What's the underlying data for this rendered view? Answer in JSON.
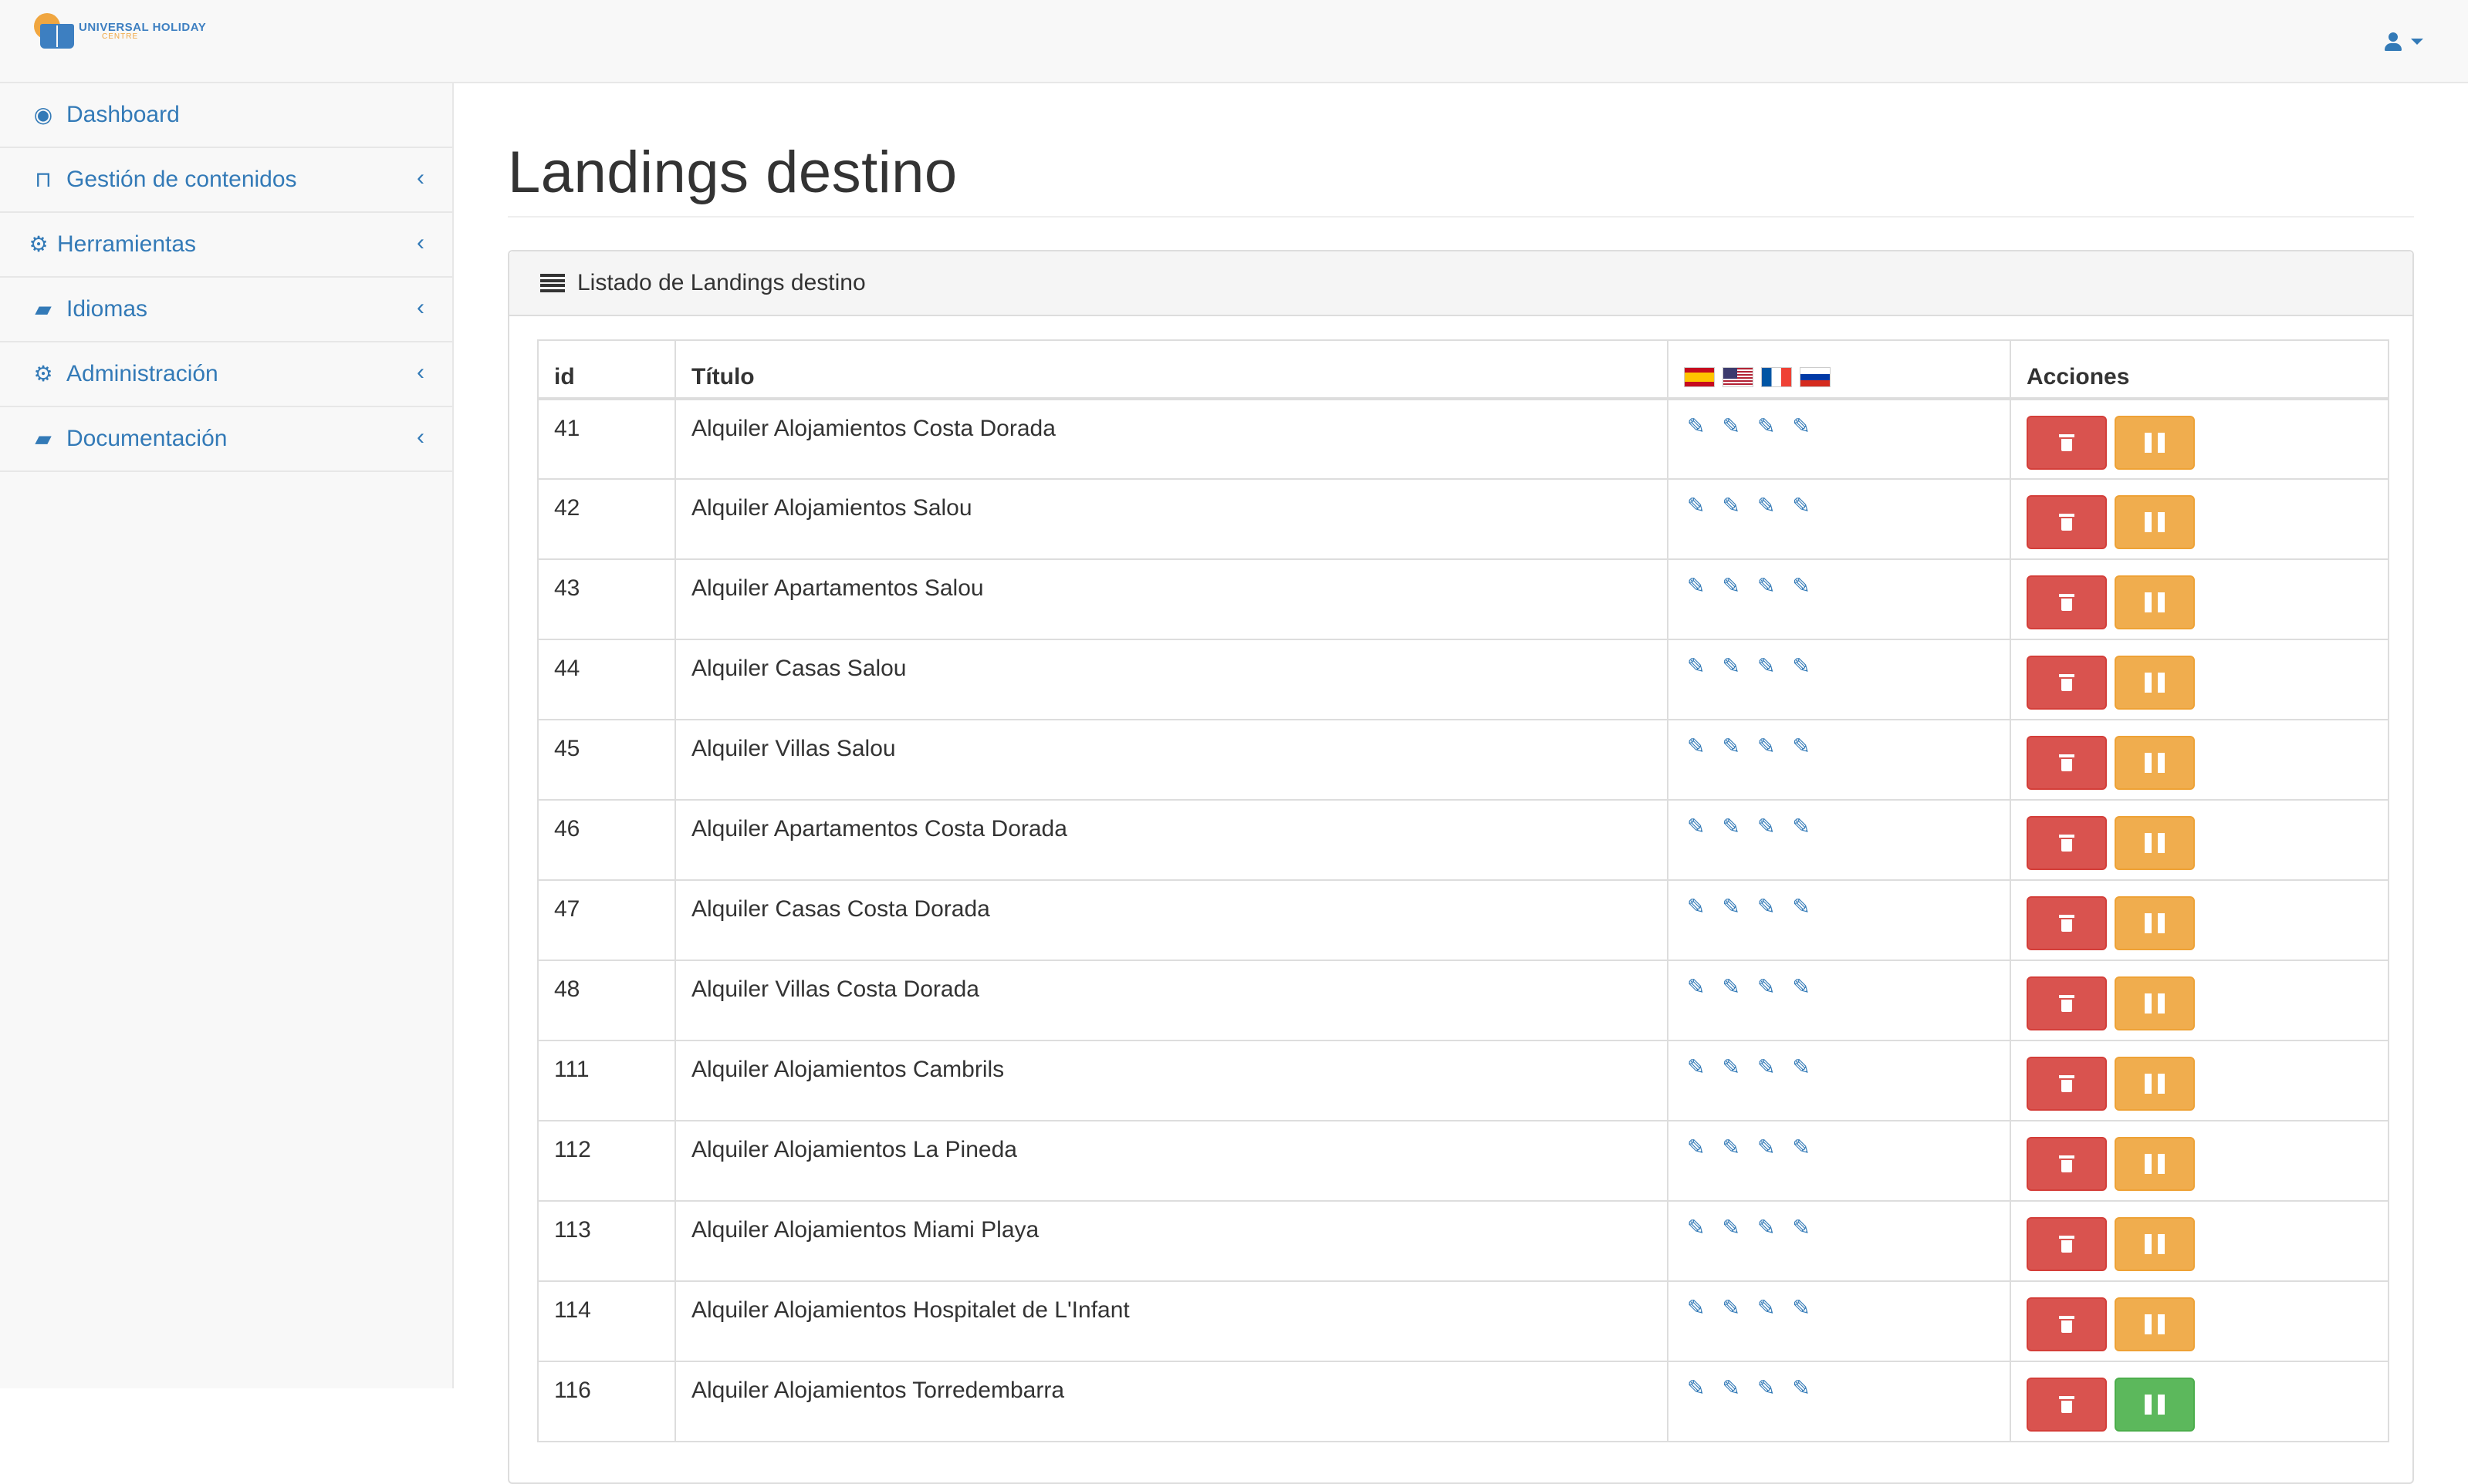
{
  "app": {
    "brand_name": "UNIVERSAL HOLIDAY",
    "brand_sub": "CENTRE"
  },
  "sidebar": {
    "items": [
      {
        "label": "Dashboard",
        "icon": "dashboard-icon",
        "has_arrow": false
      },
      {
        "label": "Gestión de contenidos",
        "icon": "bookmark-icon",
        "has_arrow": true
      },
      {
        "label": "Herramientas",
        "icon": "gear-icon",
        "has_arrow": true
      },
      {
        "label": "Idiomas",
        "icon": "book-icon",
        "has_arrow": true
      },
      {
        "label": "Administración",
        "icon": "gears-icon",
        "has_arrow": true
      },
      {
        "label": "Documentación",
        "icon": "book-icon",
        "has_arrow": true
      }
    ],
    "arrow_glyph": "‹"
  },
  "main": {
    "page_title": "Landings destino",
    "panel_title": "Listado de Landings destino",
    "columns": {
      "id": "id",
      "title": "Título",
      "actions": "Acciones"
    },
    "languages": [
      "es",
      "en",
      "fr",
      "ru"
    ],
    "rows": [
      {
        "id": "41",
        "title": "Alquiler Alojamientos Costa Dorada",
        "state": "pause"
      },
      {
        "id": "42",
        "title": "Alquiler Alojamientos Salou",
        "state": "pause"
      },
      {
        "id": "43",
        "title": "Alquiler Apartamentos Salou",
        "state": "pause"
      },
      {
        "id": "44",
        "title": "Alquiler Casas Salou",
        "state": "pause"
      },
      {
        "id": "45",
        "title": "Alquiler Villas Salou",
        "state": "pause"
      },
      {
        "id": "46",
        "title": "Alquiler Apartamentos Costa Dorada",
        "state": "pause"
      },
      {
        "id": "47",
        "title": "Alquiler Casas Costa Dorada",
        "state": "pause"
      },
      {
        "id": "48",
        "title": "Alquiler Villas Costa Dorada",
        "state": "pause"
      },
      {
        "id": "111",
        "title": "Alquiler Alojamientos Cambrils",
        "state": "pause"
      },
      {
        "id": "112",
        "title": "Alquiler Alojamientos La Pineda",
        "state": "pause"
      },
      {
        "id": "113",
        "title": "Alquiler Alojamientos Miami Playa",
        "state": "pause"
      },
      {
        "id": "114",
        "title": "Alquiler Alojamientos Hospitalet de L'Infant",
        "state": "pause"
      },
      {
        "id": "116",
        "title": "Alquiler Alojamientos Torredembarra",
        "state": "play"
      }
    ]
  },
  "colors": {
    "link": "#337ab7",
    "danger": "#d9534f",
    "warning": "#f0ad4e",
    "success": "#5cb85c"
  }
}
